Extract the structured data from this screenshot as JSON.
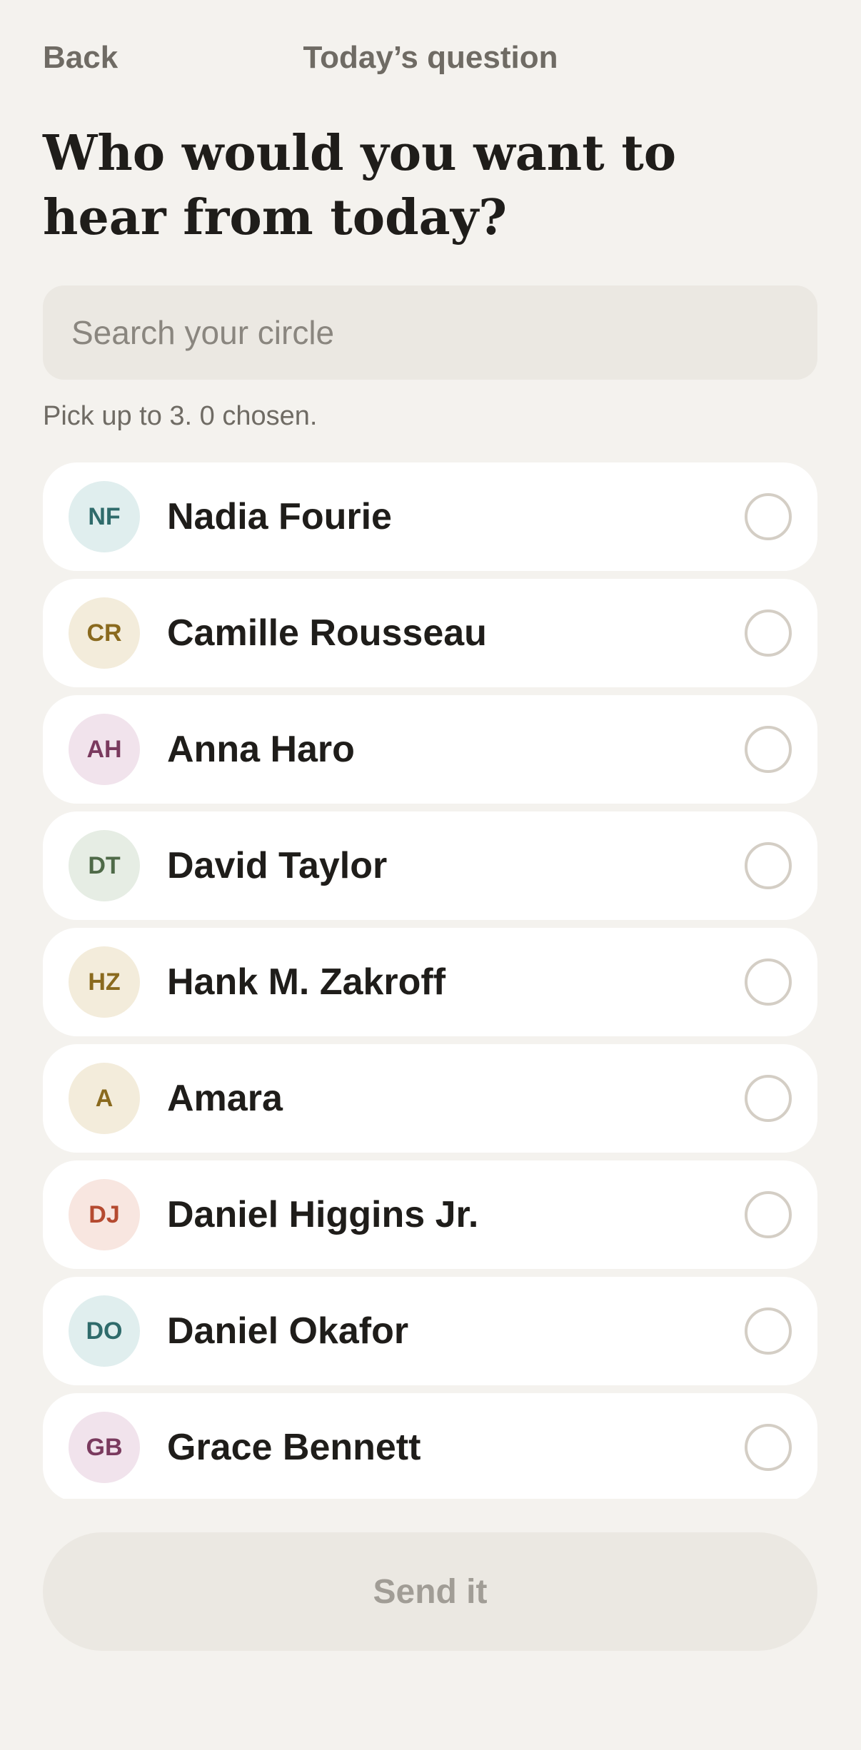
{
  "topbar": {
    "back_label": "Back",
    "title": "Today’s question"
  },
  "headline": "Who would you want to hear from today?",
  "search": {
    "placeholder": "Search your circle",
    "value": ""
  },
  "hint": "Pick up to 3. 0 chosen.",
  "contacts": [
    {
      "initials": "NF",
      "name": "Nadia Fourie",
      "avatar_bg": "#e0eeee",
      "avatar_fg": "#2f6b6b",
      "selected": false
    },
    {
      "initials": "CR",
      "name": "Camille Rousseau",
      "avatar_bg": "#f3ecdb",
      "avatar_fg": "#8a6a1e",
      "selected": false
    },
    {
      "initials": "AH",
      "name": "Anna Haro",
      "avatar_bg": "#f1e3ec",
      "avatar_fg": "#7a3a5e",
      "selected": false
    },
    {
      "initials": "DT",
      "name": "David Taylor",
      "avatar_bg": "#e6ede4",
      "avatar_fg": "#4f6a48",
      "selected": false
    },
    {
      "initials": "HZ",
      "name": "Hank M. Zakroff",
      "avatar_bg": "#f3ecdb",
      "avatar_fg": "#8a6a1e",
      "selected": false
    },
    {
      "initials": "A",
      "name": "Amara",
      "avatar_bg": "#f3ecdb",
      "avatar_fg": "#8a6a1e",
      "selected": false
    },
    {
      "initials": "DJ",
      "name": "Daniel Higgins Jr.",
      "avatar_bg": "#f8e6e0",
      "avatar_fg": "#b54a30",
      "selected": false
    },
    {
      "initials": "DO",
      "name": "Daniel Okafor",
      "avatar_bg": "#e0eeee",
      "avatar_fg": "#2f6b6b",
      "selected": false
    },
    {
      "initials": "GB",
      "name": "Grace Bennett",
      "avatar_bg": "#f1e3ec",
      "avatar_fg": "#7a3a5e",
      "selected": false
    }
  ],
  "send_button": {
    "label": "Send it",
    "enabled": false
  },
  "colors": {
    "background": "#f4f2ee",
    "card": "#ffffff",
    "muted_text": "#6f6b64",
    "radio_border": "#d4cec5"
  }
}
